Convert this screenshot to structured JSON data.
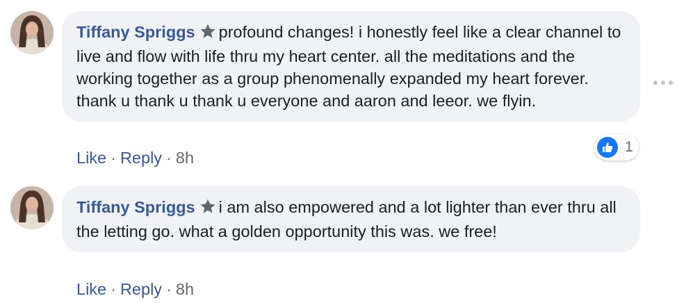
{
  "comments": [
    {
      "author": "Tiffany Spriggs",
      "text": "profound changes! i honestly feel like a clear channel to live and flow with life thru my heart center. all the meditations and the working together as a group phenomenally expanded my heart forever. thank u thank u thank u everyone and aaron and leeor. we flyin.",
      "like_label": "Like",
      "reply_label": "Reply",
      "timestamp": "8h",
      "reaction_count": "1"
    },
    {
      "author": "Tiffany Spriggs",
      "text": "i am also empowered and a lot lighter than ever thru all the letting go. what a golden opportunity this was. we free!",
      "like_label": "Like",
      "reply_label": "Reply",
      "timestamp": "8h"
    }
  ],
  "separator": "·",
  "icons": {
    "badge": "star-badge-icon",
    "more": "more-options-icon",
    "reaction": "thumbs-up-icon"
  },
  "colors": {
    "author": "#385898",
    "bubble": "#f0f2f5",
    "like_reaction": "#1877f2"
  }
}
